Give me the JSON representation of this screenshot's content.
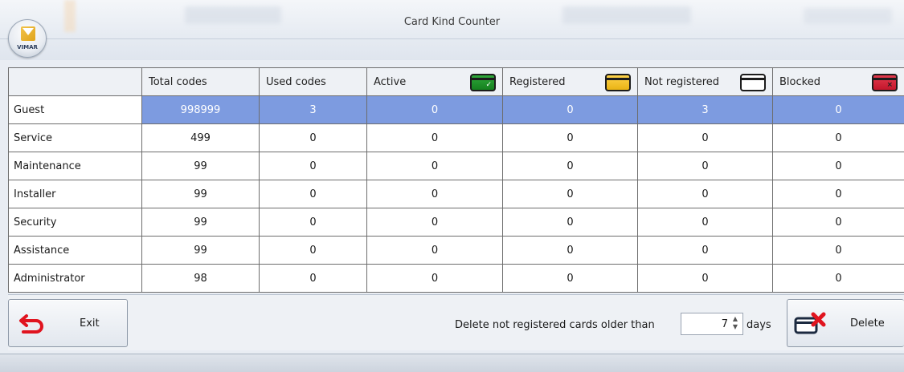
{
  "window": {
    "title": "Card Kind Counter",
    "logo_text": "VIMAR"
  },
  "table": {
    "headers": [
      "",
      "Total codes",
      "Used codes",
      "Active",
      "Registered",
      "Not registered",
      "Blocked"
    ],
    "header_icons": {
      "active": "card-active-icon",
      "registered": "card-registered-icon",
      "not_registered": "card-not-registered-icon",
      "blocked": "card-blocked-icon"
    },
    "rows": [
      [
        "Guest",
        "998999",
        "3",
        "0",
        "0",
        "3",
        "0"
      ],
      [
        "Service",
        "499",
        "0",
        "0",
        "0",
        "0",
        "0"
      ],
      [
        "Maintenance",
        "99",
        "0",
        "0",
        "0",
        "0",
        "0"
      ],
      [
        "Installer",
        "99",
        "0",
        "0",
        "0",
        "0",
        "0"
      ],
      [
        "Security",
        "99",
        "0",
        "0",
        "0",
        "0",
        "0"
      ],
      [
        "Assistance",
        "99",
        "0",
        "0",
        "0",
        "0",
        "0"
      ],
      [
        "Administrator",
        "98",
        "0",
        "0",
        "0",
        "0",
        "0"
      ]
    ],
    "selected_row": "Guest"
  },
  "footer": {
    "exit_label": "Exit",
    "delete_prompt": "Delete not registered cards older than",
    "days_value": "7",
    "days_label": "days",
    "delete_label": "Delete"
  },
  "colors": {
    "selection": "#7d9be0",
    "active_card": "#1f9a2b",
    "registered_card": "#f4c228",
    "blocked_card": "#d7273b",
    "exit_icon": "#e0141f"
  }
}
